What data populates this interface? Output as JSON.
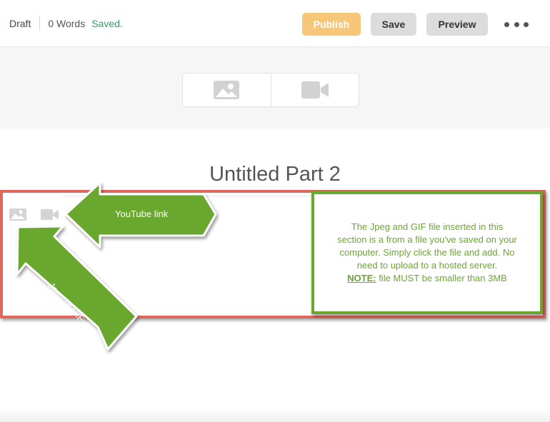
{
  "topbar": {
    "status": "Draft",
    "word_count": "0 Words",
    "save_state": "Saved.",
    "publish_label": "Publish",
    "save_label": "Save",
    "preview_label": "Preview",
    "more_icon": "more-horizontal-icon"
  },
  "media_header": {
    "image_icon": "image-icon",
    "video_icon": "video-icon"
  },
  "part": {
    "title": "Untitled Part 2"
  },
  "annotations": {
    "youtube_arrow": "YouTube link",
    "jpeg_arrow": "Jpeg or GIF",
    "note": {
      "line1": "The Jpeg and GIF file inserted in this",
      "line2": "section is a from a file you've saved on your",
      "line3": "computer. Simply click the file and add. No",
      "line4": "need to upload to a hosted server.",
      "label": "NOTE:",
      "line5": " file MUST be smaller than 3MB"
    },
    "colors": {
      "green": "#6aa72f",
      "red": "#e0675b",
      "publish": "#f6c779",
      "saved": "#2e9e5e"
    }
  }
}
